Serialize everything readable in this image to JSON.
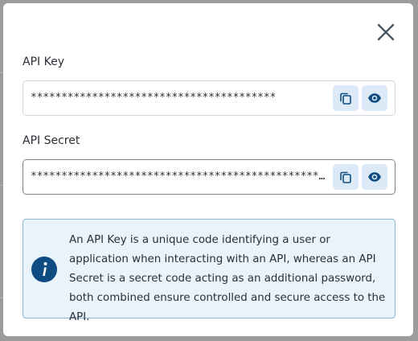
{
  "dialog": {
    "close_icon": "close-icon",
    "api_key": {
      "label": "API Key",
      "masked_value": "****************************************",
      "copy_icon": "copy-icon",
      "show_icon": "eye-icon"
    },
    "api_secret": {
      "label": "API Secret",
      "masked_value": "************************************************…",
      "copy_icon": "copy-icon",
      "show_icon": "eye-icon"
    },
    "info": {
      "icon": "info-icon",
      "text": "An API Key is a unique code identifying a user or application when interacting with an API, whereas an API Secret is a secret code acting as an additional password, both combined ensure controlled and secure access to the API."
    }
  },
  "colors": {
    "accent": "#0f4c81",
    "icon_button_bg": "#dceaf7",
    "info_bg": "#e8f3fc",
    "info_border": "#86b6d4",
    "backdrop": "#9c9c9c"
  }
}
